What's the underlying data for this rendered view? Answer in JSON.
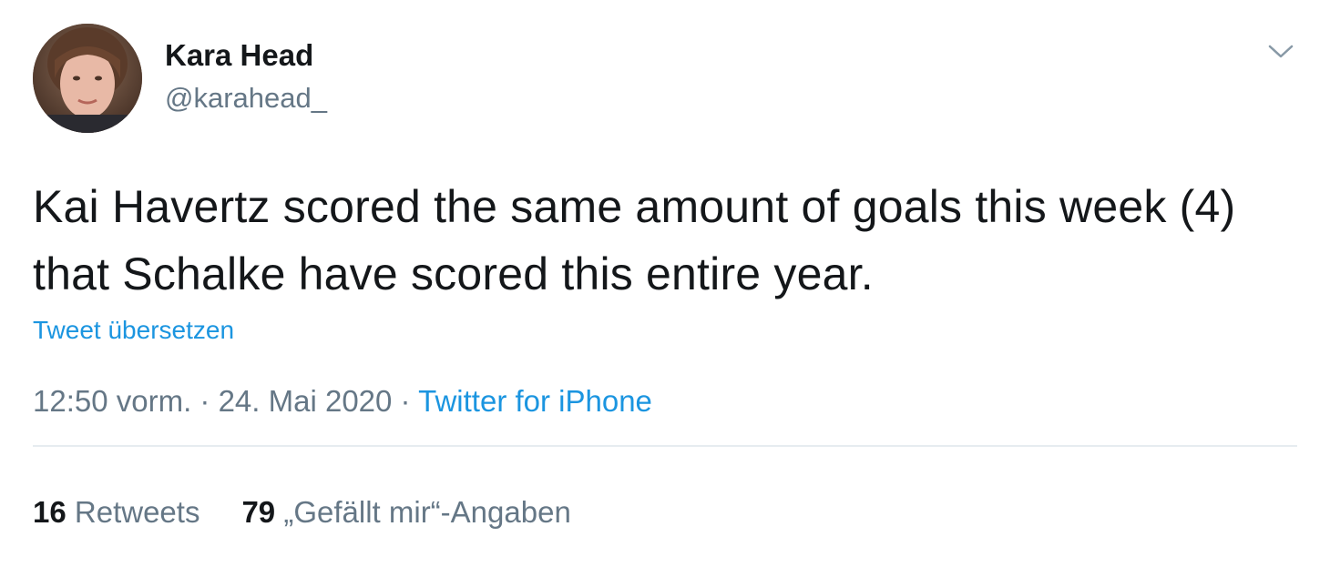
{
  "tweet": {
    "author": {
      "name": "Kara Head",
      "handle": "@karahead_"
    },
    "text": "Kai Havertz scored the same amount of goals this week (4) that Schalke have scored this entire year.",
    "translate_label": "Tweet übersetzen",
    "time": "12:50 vorm.",
    "separator": " · ",
    "date": "24. Mai 2020",
    "source": "Twitter for iPhone",
    "retweets": {
      "count": "16",
      "label": "Retweets"
    },
    "likes": {
      "count": "79",
      "label": "„Gefällt mir“-Angaben"
    }
  },
  "icons": {
    "menu": "chevron-down-icon",
    "avatar": "profile-photo"
  },
  "colors": {
    "link": "#1b95e0",
    "secondary_text": "#657786",
    "primary_text": "#14171a",
    "divider": "#e6ecf0"
  }
}
